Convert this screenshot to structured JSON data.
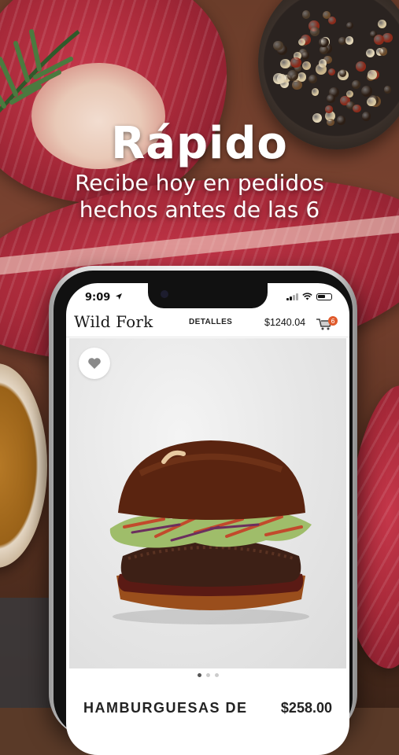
{
  "promo": {
    "title": "Rápido",
    "subtitle_line1": "Recibe hoy en pedidos",
    "subtitle_line2": "hechos antes de las 6"
  },
  "status_bar": {
    "time": "9:09"
  },
  "app_bar": {
    "logo": "Wild Fork",
    "nav_label": "DETALLES",
    "cart_total": "$1240.04",
    "cart_count": "6"
  },
  "product": {
    "name": "HAMBURGUESAS DE",
    "price": "$258.00",
    "image_index": 1,
    "image_count": 3
  },
  "colors": {
    "accent": "#e05a2b"
  },
  "icons": [
    "location-arrow-icon",
    "signal-icon",
    "wifi-icon",
    "battery-icon",
    "cart-icon",
    "heart-icon"
  ]
}
